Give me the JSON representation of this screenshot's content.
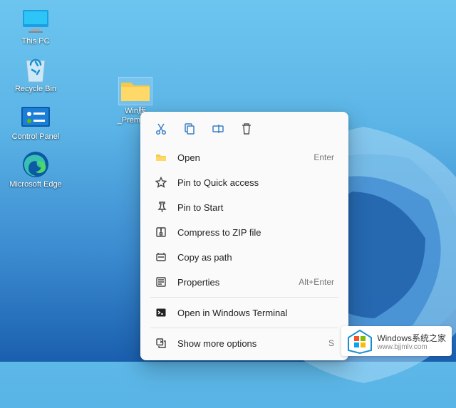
{
  "desktop": {
    "icons": [
      {
        "name": "this-pc",
        "label": "This PC"
      },
      {
        "name": "recycle-bin",
        "label": "Recycle Bin"
      },
      {
        "name": "control-panel",
        "label": "Control Panel"
      },
      {
        "name": "microsoft-edge",
        "label": "Microsoft Edge"
      }
    ],
    "folder": {
      "name": "selected-folder",
      "label": "Win版_Premiere"
    }
  },
  "context_menu": {
    "top_actions": [
      {
        "name": "cut-icon"
      },
      {
        "name": "copy-icon"
      },
      {
        "name": "rename-icon"
      },
      {
        "name": "delete-icon"
      }
    ],
    "items": [
      {
        "name": "open",
        "icon": "folder-icon",
        "label": "Open",
        "accel": "Enter"
      },
      {
        "name": "pin-quick-access",
        "icon": "star-icon",
        "label": "Pin to Quick access",
        "accel": ""
      },
      {
        "name": "pin-start",
        "icon": "pin-icon",
        "label": "Pin to Start",
        "accel": ""
      },
      {
        "name": "compress-zip",
        "icon": "zip-icon",
        "label": "Compress to ZIP file",
        "accel": ""
      },
      {
        "name": "copy-as-path",
        "icon": "path-icon",
        "label": "Copy as path",
        "accel": ""
      },
      {
        "name": "properties",
        "icon": "properties-icon",
        "label": "Properties",
        "accel": "Alt+Enter"
      }
    ],
    "items2": [
      {
        "name": "open-terminal",
        "icon": "terminal-icon",
        "label": "Open in Windows Terminal",
        "accel": ""
      }
    ],
    "items3": [
      {
        "name": "show-more",
        "icon": "more-icon",
        "label": "Show more options",
        "accel": "S"
      }
    ]
  },
  "watermark": {
    "title": "Windows系统之家",
    "url": "www.bjjmlv.com"
  }
}
